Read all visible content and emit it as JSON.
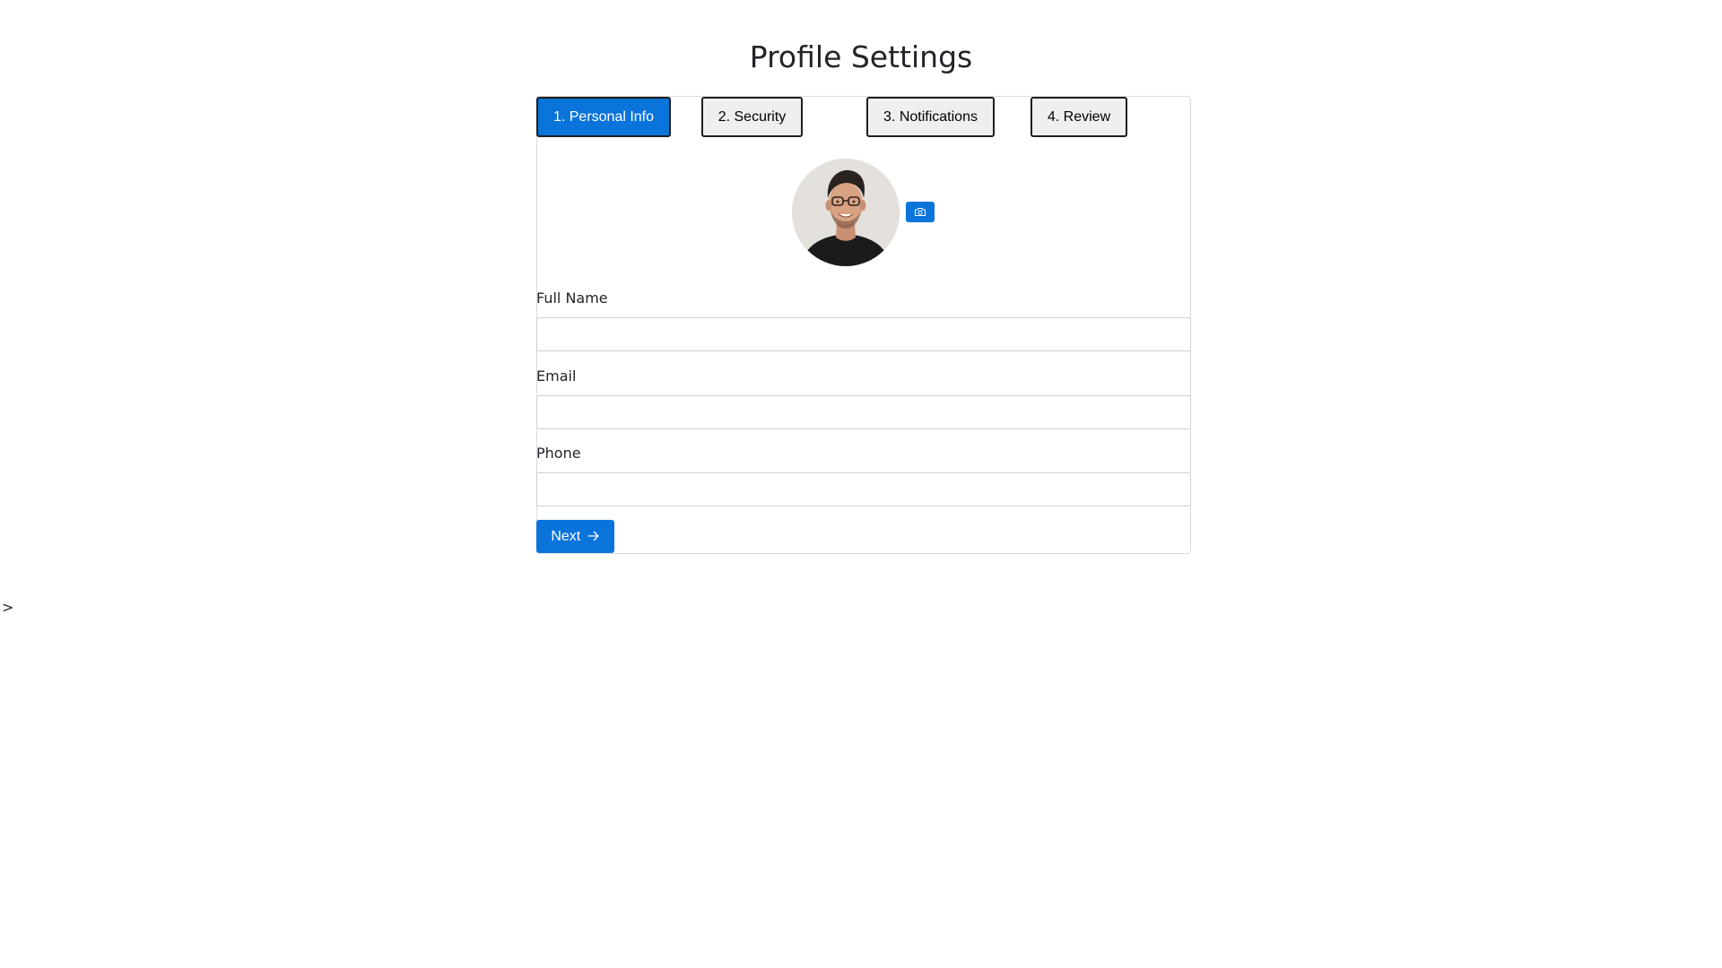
{
  "page": {
    "title": "Profile Settings",
    "stray_text": ">"
  },
  "steps": [
    {
      "label": "1. Personal Info",
      "active": true
    },
    {
      "label": "2. Security",
      "active": false
    },
    {
      "label": "3. Notifications",
      "active": false
    },
    {
      "label": "4. Review",
      "active": false
    }
  ],
  "avatar": {
    "icon": "profile-photo",
    "upload_icon": "camera-icon"
  },
  "form": {
    "full_name_label": "Full Name",
    "full_name_value": "",
    "email_label": "Email",
    "email_value": "",
    "phone_label": "Phone",
    "phone_value": ""
  },
  "actions": {
    "next_label": "Next",
    "next_icon": "arrow-right-icon"
  },
  "colors": {
    "accent": "#0a74da",
    "tab_inactive_bg": "#efefef",
    "tab_border": "#1f1f1f",
    "text": "#212529",
    "border": "#dcdcdc"
  }
}
